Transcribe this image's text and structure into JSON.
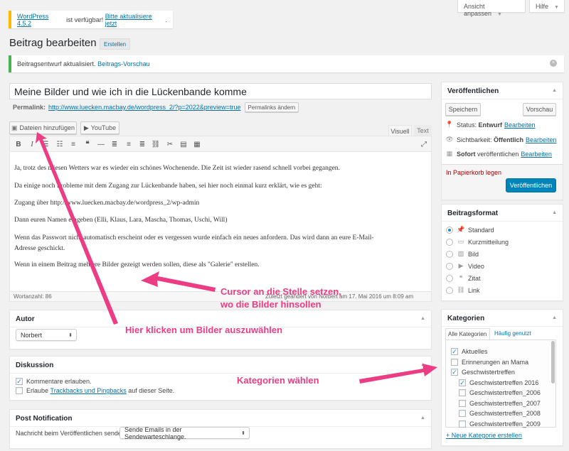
{
  "topbar": {
    "screen_options": "Ansicht anpassen",
    "help": "Hilfe"
  },
  "update_notice": {
    "version_link": "WordPress 4.5.2",
    "text": " ist verfügbar! ",
    "update_link": "Bitte aktualisiere jetzt",
    "end": "."
  },
  "page": {
    "title": "Beitrag bearbeiten",
    "add_new": "Erstellen"
  },
  "draft_notice": {
    "text": "Beitragsentwurf aktualisiert. ",
    "preview_link": "Beitrags-Vorschau"
  },
  "post": {
    "title": "Meine Bilder und wie ich in die Lückenbande komme",
    "permalink_label": "Permalink:",
    "permalink_url": "http://www.luecken.macbay.de/wordpress_2/?p=2022&preview=true",
    "permalink_button": "Permalinks ändern"
  },
  "media": {
    "add_media": "Dateien hinzufügen",
    "youtube": "YouTube"
  },
  "editor_tabs": {
    "visual": "Visuell",
    "text": "Text"
  },
  "toolbar": {
    "bold": "B",
    "italic": "I"
  },
  "content": [
    "Ja, trotz des miesen Wetters war es wieder ein schönes Wochenende. Die Zeit ist wieder rasend schnell vorbei gegangen.",
    "Da einige noch Probleme mit dem Zugang zur Lückenbande haben, sei hier noch einmal kurz erklärt, wie es geht:",
    "Zugang über http://www.luecken.macbay.de/wordpress_2/wp-admin",
    "Dann euren Namen eingeben (Elli, Klaus, Lara, Mascha, Thomas, Uschi, Will)",
    "Wenn das Passwort nicht automatisch erscheint oder es vergessen wurde einfach ein neues anfordern. Das wird dann an eure E-Mail-",
    "Adresse geschickt.",
    "Wenn in einem Beitrag mehrere Bilder gezeigt werden sollen, diese als \"Galerie\" erstellen."
  ],
  "status_bar": {
    "word_count": "Wortanzahl: 86",
    "last_edit": "Zuletzt geändert von Norbert am 17. Mai 2016 um 8:09 am"
  },
  "author": {
    "title": "Autor",
    "value": "Norbert"
  },
  "discussion": {
    "title": "Diskussion",
    "comments": "Kommentare erlauben.",
    "allow": "Erlaube ",
    "trackbacks": "Trackbacks und Pingbacks",
    "suffix": " auf dieser Seite."
  },
  "post_notification": {
    "title": "Post Notification",
    "label": "Nachricht beim Veröffentlichen senden",
    "value": "Sende Emails in der Sendewarteschlange."
  },
  "publish": {
    "title": "Veröffentlichen",
    "save": "Speichern",
    "preview": "Vorschau",
    "status_label": "Status: ",
    "status_value": "Entwurf",
    "status_edit": "Bearbeiten",
    "visibility_label": "Sichtbarkeit: ",
    "visibility_value": "Öffentlich",
    "visibility_edit": "Bearbeiten",
    "schedule_value": "Sofort",
    "schedule_label": " veröffentlichen",
    "schedule_edit": "Bearbeiten",
    "trash": "In Papierkorb legen",
    "publish_button": "Veröffentlichen"
  },
  "format": {
    "title": "Beitragsformat",
    "options": [
      {
        "label": "Standard",
        "icon": "pin-icon"
      },
      {
        "label": "Kurzmitteilung",
        "icon": "aside-icon"
      },
      {
        "label": "Bild",
        "icon": "image-icon"
      },
      {
        "label": "Video",
        "icon": "video-icon"
      },
      {
        "label": "Zitat",
        "icon": "quote-icon"
      },
      {
        "label": "Link",
        "icon": "link-icon"
      }
    ]
  },
  "categories": {
    "title": "Kategorien",
    "tab_all": "Alle Kategorien",
    "tab_popular": "Häufig genutzt",
    "items": [
      {
        "label": "Aktuelles",
        "checked": true
      },
      {
        "label": "Erinnerungen an Mama",
        "checked": false
      },
      {
        "label": "Geschwistertreffen",
        "checked": true
      },
      {
        "label": "Geschwistertreffen 2016",
        "checked": true
      },
      {
        "label": "Geschwistertreffen_2006",
        "checked": false
      },
      {
        "label": "Geschwistertreffen_2007",
        "checked": false
      },
      {
        "label": "Geschwistertreffen_2008",
        "checked": false
      },
      {
        "label": "Geschwistertreffen_2009",
        "checked": false
      }
    ],
    "add_new": "+ Neue Kategorie erstellen"
  },
  "annotations": {
    "cursor_line1": "Cursor an die Stelle setzen,",
    "cursor_line2": "wo die Bilder hinsollen",
    "click": "Hier klicken um Bilder auszuwählen",
    "categories": "Kategorien wählen"
  },
  "colors": {
    "accent": "#0073aa",
    "primary_button": "#0085ba",
    "annotation": "#ec3d84",
    "trash": "#a00",
    "notice_warning": "#ffb900",
    "notice_success": "#46b450"
  }
}
